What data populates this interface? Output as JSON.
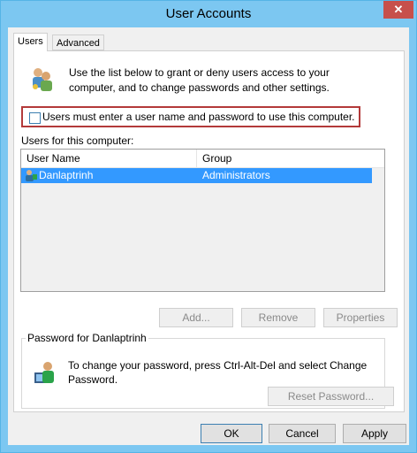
{
  "window": {
    "title": "User Accounts"
  },
  "tabs": [
    {
      "label": "Users",
      "active": true
    },
    {
      "label": "Advanced",
      "active": false
    }
  ],
  "users_tab": {
    "intro": "Use the list below to grant or deny users access to your computer, and to change passwords and other settings.",
    "require_login_label": "Users must enter a user name and password to use this computer.",
    "require_login_checked": false,
    "users_label": "Users for this computer:",
    "columns": [
      "User Name",
      "Group"
    ],
    "rows": [
      {
        "name": "Danlaptrinh",
        "group": "Administrators",
        "selected": true
      }
    ],
    "buttons": {
      "add": "Add...",
      "remove": "Remove",
      "properties": "Properties"
    },
    "password_group": {
      "title": "Password for Danlaptrinh",
      "text": "To change your password, press Ctrl-Alt-Del and select Change Password.",
      "reset_button": "Reset Password..."
    }
  },
  "footer": {
    "ok": "OK",
    "cancel": "Cancel",
    "apply": "Apply"
  },
  "icons": {
    "close": "close-icon",
    "users": "users-icon",
    "user": "user-icon",
    "password": "password-user-icon"
  },
  "colors": {
    "titlebar": "#7cc7f1",
    "close": "#c7504b",
    "selection": "#3399ff",
    "highlight_border": "#b33a3a"
  }
}
